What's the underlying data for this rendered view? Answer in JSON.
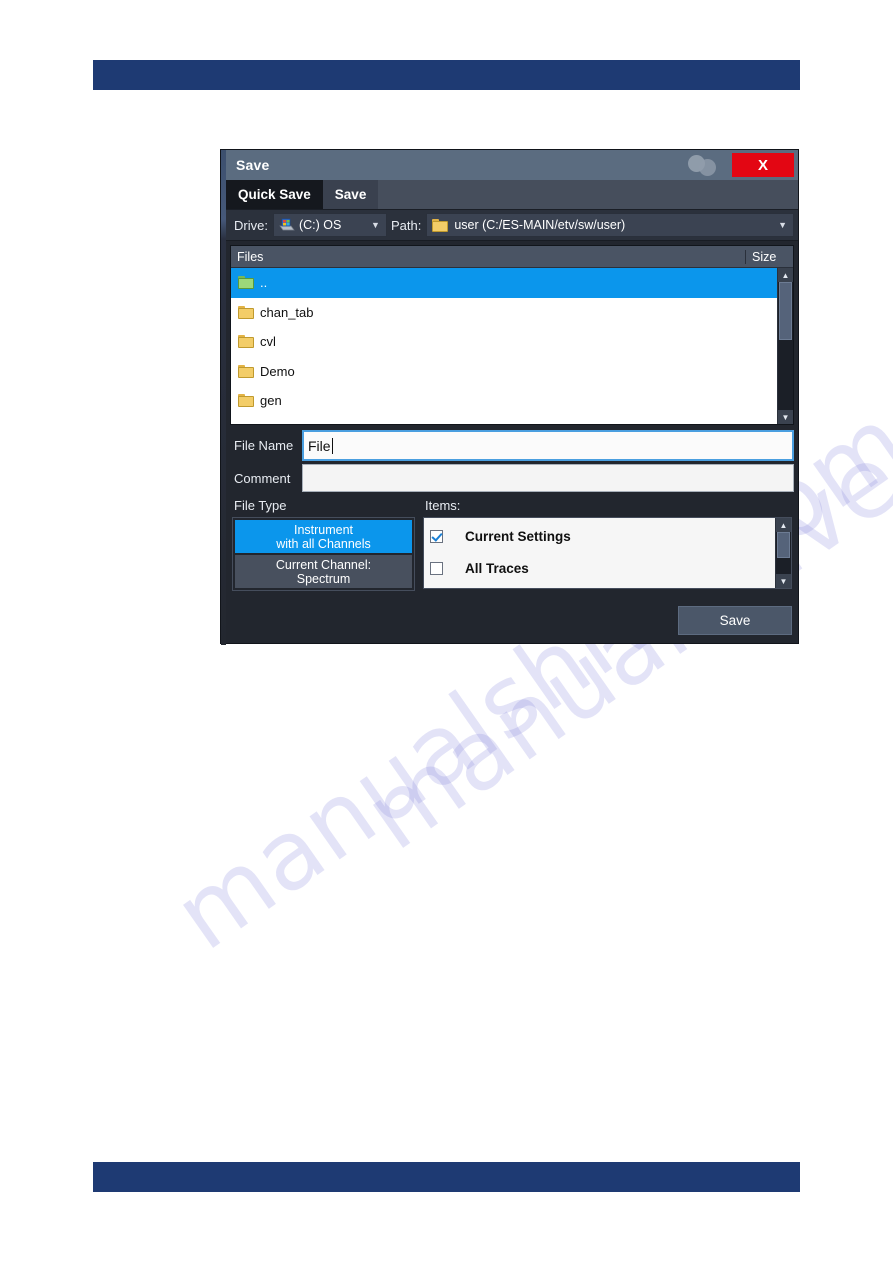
{
  "page": {
    "header_band_color": "#1e3a73",
    "footer_band_color": "#1e3a73",
    "watermark_a": "manualshive.com",
    "watermark_b": "manualshive.com"
  },
  "dialog": {
    "title": "Save",
    "close_label": "X",
    "help_icon": "overlapping-circles-icon",
    "tabs": [
      {
        "label": "Quick Save",
        "active": false
      },
      {
        "label": "Save",
        "active": true
      }
    ],
    "drive": {
      "label": "Drive:",
      "value": "(C:) OS",
      "icon": "drive-icon",
      "caret": "▼"
    },
    "path": {
      "label": "Path:",
      "value": "user (C:/ES-MAIN/etv/sw/user)",
      "icon": "folder-icon",
      "caret": "▼"
    },
    "file_list": {
      "columns": [
        "Files",
        "Size"
      ],
      "rows": [
        {
          "name": "..",
          "size": "",
          "selected": true
        },
        {
          "name": "chan_tab",
          "size": "",
          "selected": false
        },
        {
          "name": "cvl",
          "size": "",
          "selected": false
        },
        {
          "name": "Demo",
          "size": "",
          "selected": false
        },
        {
          "name": "gen",
          "size": "",
          "selected": false
        }
      ],
      "scroll_up": "▲",
      "scroll_down": "▼"
    },
    "file_name": {
      "label": "File Name",
      "value": "File",
      "placeholder": ""
    },
    "comment": {
      "label": "Comment",
      "value": "",
      "placeholder": ""
    },
    "file_type": {
      "label": "File Type",
      "options": [
        {
          "line1": "Instrument",
          "line2": "with all Channels",
          "selected": true
        },
        {
          "line1": "Current Channel:",
          "line2": "Spectrum",
          "selected": false
        }
      ]
    },
    "items": {
      "label": "Items:",
      "entries": [
        {
          "label": "Current Settings",
          "checked": true
        },
        {
          "label": "All Traces",
          "checked": false
        }
      ],
      "scroll_up": "▲",
      "scroll_down": "▼"
    },
    "save_button": "Save",
    "colors": {
      "titlebar": "#5b6c80",
      "accent_blue": "#0b96ec",
      "close_red": "#e30613",
      "dialog_bg": "#22262e"
    }
  }
}
